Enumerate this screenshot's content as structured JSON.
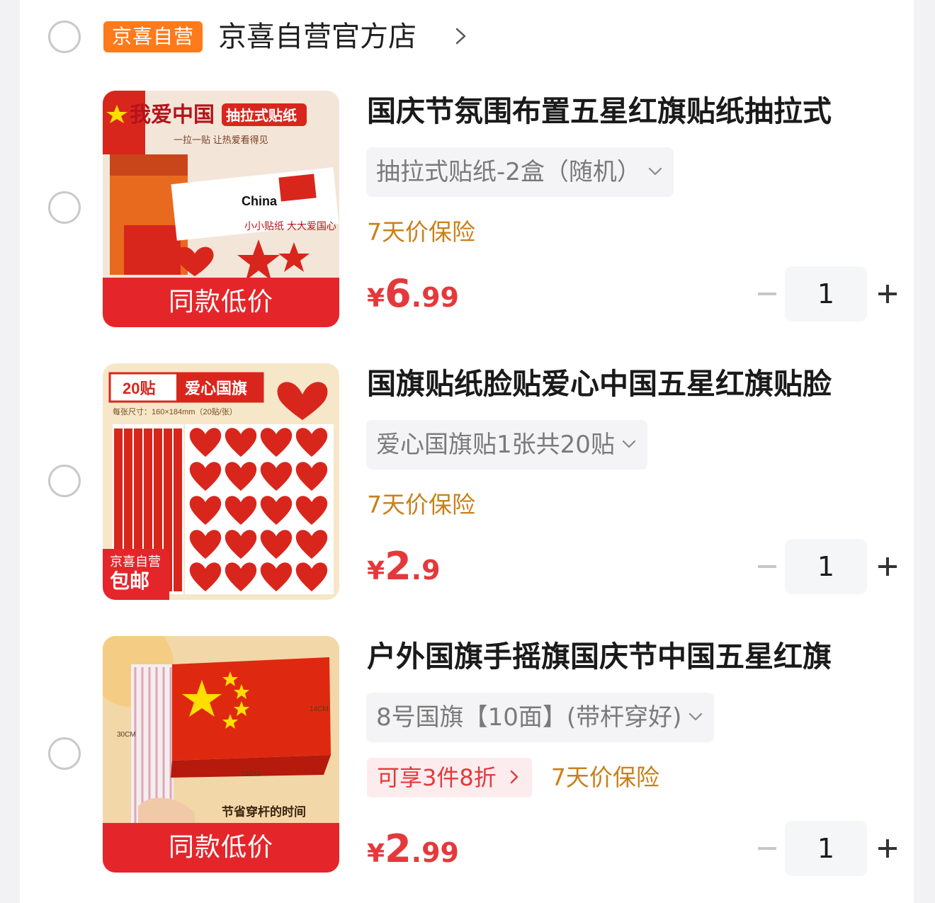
{
  "shop": {
    "badge": "京喜自营",
    "name": "京喜自营官方店"
  },
  "items": [
    {
      "title": "国庆节氛围布置五星红旗贴纸抽拉式",
      "variant": "抽拉式贴纸-2盒（随机）",
      "discount_tag": "",
      "insurance_tag": "7天价保险",
      "price": {
        "symbol": "¥",
        "integer": "6",
        "decimal": ".99"
      },
      "quantity": "1",
      "image_badge": "同款低价",
      "image_text": {
        "headline": "我爱中国",
        "sub": "抽拉式贴纸",
        "slogan": "一拉一贴 让热爱看得见",
        "sticker": "China",
        "note": "小小贴纸 大大爱国心"
      }
    },
    {
      "title": "国旗贴纸脸贴爱心中国五星红旗贴脸",
      "variant": "爱心国旗贴1张共20贴",
      "discount_tag": "",
      "insurance_tag": "7天价保险",
      "price": {
        "symbol": "¥",
        "integer": "2",
        "decimal": ".9"
      },
      "quantity": "1",
      "image_badge": {
        "line1": "京喜自营",
        "line2": "包邮"
      },
      "image_text": {
        "count": "20贴",
        "name": "爱心国旗",
        "size": "每张尺寸：160×184mm（20贴/张）"
      }
    },
    {
      "title": "户外国旗手摇旗国庆节中国五星红旗",
      "variant": "8号国旗【10面】(带杆穿好)",
      "discount_tag": "可享3件8折",
      "insurance_tag": "7天价保险",
      "price": {
        "symbol": "¥",
        "integer": "2",
        "decimal": ".99"
      },
      "quantity": "1",
      "image_badge": "同款低价",
      "image_text": {
        "height": "14CM",
        "pole": "30CM",
        "width": "21CM",
        "caption": "节省穿杆的时间"
      }
    }
  ],
  "colors": {
    "price_red": "#e4393c",
    "insurance_orange": "#c8811b",
    "shop_badge_orange": "#ff7a1a",
    "flag_red": "#de2910",
    "flag_yellow": "#ffde00"
  }
}
